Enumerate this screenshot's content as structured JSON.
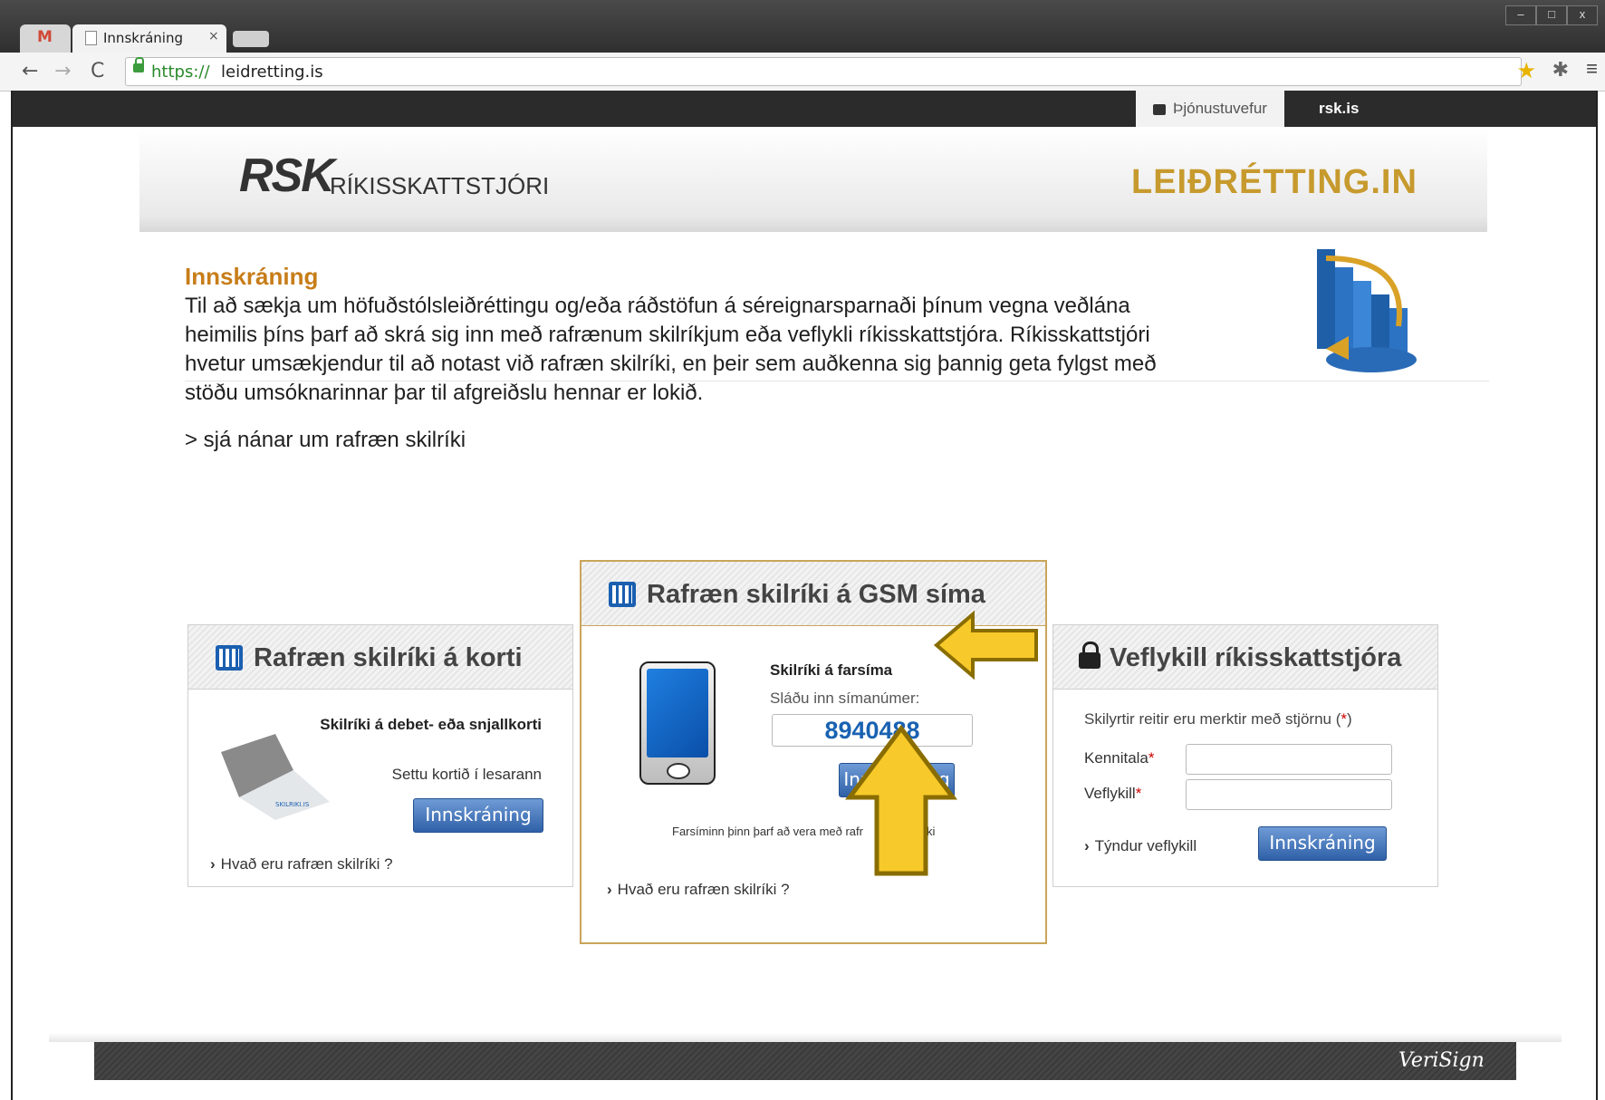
{
  "browser": {
    "tabs": [
      {
        "label": "Innskráning",
        "close": "×"
      }
    ],
    "gmail_glyph": "M",
    "window_controls": [
      "–",
      "□",
      "x"
    ],
    "url": {
      "scheme": "https://",
      "rest": "leidretting.is"
    },
    "icons": [
      "back-arrow-icon",
      "forward-arrow-icon",
      "reload-icon",
      "lock-icon",
      "star-icon",
      "extension-icon",
      "menu-icon"
    ]
  },
  "topnav": {
    "service": "Þjónustuvefur",
    "rsk": "rsk.is"
  },
  "header": {
    "rsk_logo": "RSK",
    "rsk_subtitle": "RÍKISSKATTSTJÓRI",
    "site_logo": "LEIÐRÉTTING.IN"
  },
  "intro": {
    "title": "Innskráning",
    "body": "Til að sækja um höfuðstólsleiðréttingu og/eða ráðstöfun á séreignarsparnaði þínum vegna veðlána heimilis þíns þarf að skrá sig inn með rafrænum skilríkjum eða veflykli ríkisskattstjóra. Ríkisskattstjóri hvetur umsækjendur til að notast við rafræn skilríki, en þeir sem auðkenna sig þannig geta fylgst með stöðu umsóknarinnar þar til afgreiðslu hennar er lokið.",
    "more_link": "> sjá nánar um rafræn skilríki"
  },
  "panel_card": {
    "title": "Rafræn skilríki á korti",
    "subtitle": "Skilríki á debet- eða snjallkorti",
    "instruction": "Settu kortið í lesarann",
    "button": "Innskráning",
    "link": "Hvað eru rafræn skilríki ?",
    "card_text": "SKILRIKI.IS"
  },
  "panel_gsm": {
    "title": "Rafræn skilríki á GSM síma",
    "subtitle": "Skilríki á farsíma",
    "input_label": "Sláðu inn símanúmer:",
    "phone_number": "8940488",
    "button": "Innskráning",
    "note": "Farsíminn þinn þarf að vera með rafr",
    "note_end": "ki",
    "link": "Hvað eru rafræn skilríki ?"
  },
  "panel_key": {
    "title": "Veflykill ríkisskattstjóra",
    "required_note": "Skilyrtir reitir eru merktir með stjörnu (",
    "required_star": "*",
    "required_close": ")",
    "kennitala_label": "Kennitala",
    "veflykill_label": "Veflykill",
    "star": "*",
    "kennitala_value": "",
    "veflykill_value": "",
    "lost_key": "Týndur veflykill",
    "button": "Innskráning"
  },
  "footer": {
    "verisign": "VeriSign"
  },
  "colors": {
    "accent_orange": "#c77d18",
    "logo_gold": "#c79a2e",
    "button_blue": "#2f61a8",
    "number_blue": "#1962b2",
    "annotation_yellow": "#f7c92a"
  }
}
